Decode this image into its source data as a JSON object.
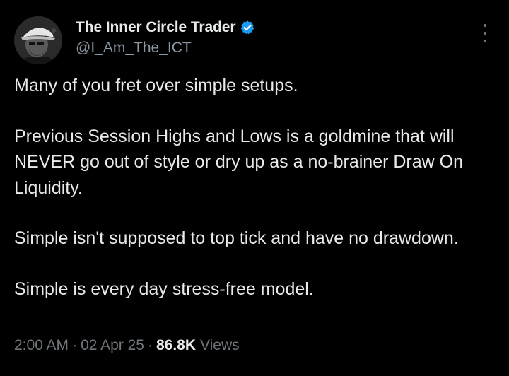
{
  "author": {
    "display_name": "The Inner Circle Trader",
    "handle": "@I_Am_The_ICT",
    "verified": true,
    "verified_color": "#1d9bf0",
    "avatar_icon": "avatar-photo"
  },
  "more_icon": "more-options-icon",
  "tweet": {
    "paragraphs": [
      "Many of you fret over simple setups.",
      "Previous Session Highs and Lows is a goldmine that will NEVER go out of style or dry up as a no-brainer Draw On Liquidity.",
      "Simple isn't supposed to top tick and have no drawdown.",
      "Simple is every day stress-free model."
    ]
  },
  "meta": {
    "time": "2:00 AM",
    "separator": "·",
    "date": "02 Apr 25",
    "views_count": "86.8K",
    "views_label": "Views"
  },
  "colors": {
    "background": "#000000",
    "text": "#e7e9ea",
    "secondary_text": "#71767b",
    "divider": "#2f3336"
  }
}
